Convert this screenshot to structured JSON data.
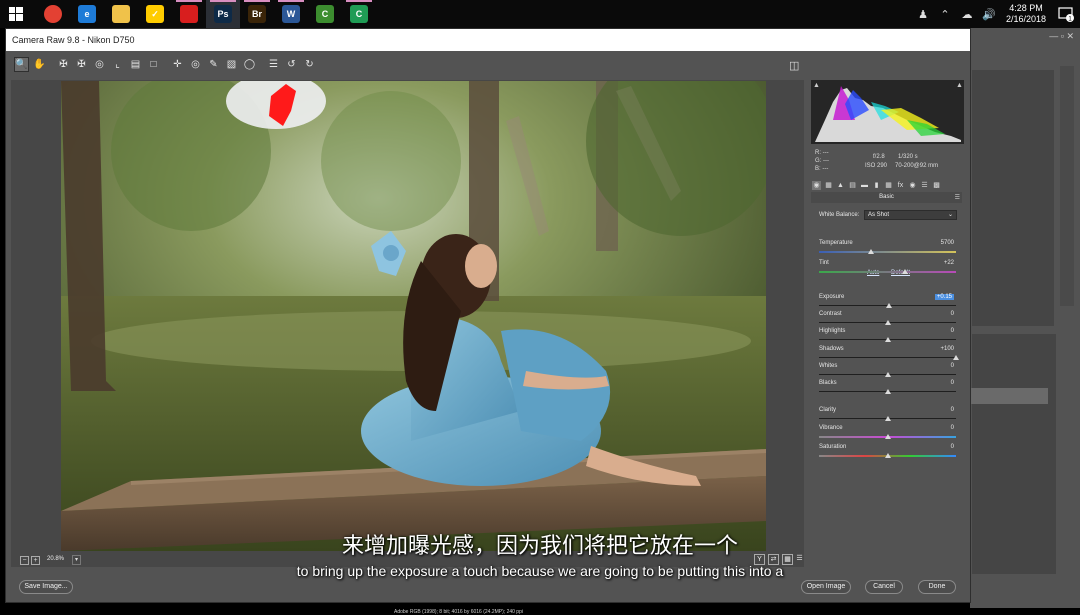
{
  "taskbar": {
    "apps": [
      {
        "name": "chrome",
        "label": "",
        "color": "#e34133",
        "active": false
      },
      {
        "name": "edge",
        "label": "e",
        "color": "#1e7bd7",
        "active": false
      },
      {
        "name": "file-explorer",
        "label": "",
        "color": "#f0c24a",
        "active": false
      },
      {
        "name": "norton",
        "label": "✓",
        "color": "#ffcc00",
        "active": false
      },
      {
        "name": "creative-cloud",
        "label": "",
        "color": "#d81e1e",
        "active": false
      },
      {
        "name": "photoshop",
        "label": "Ps",
        "color": "#0e2a47",
        "active": true
      },
      {
        "name": "bridge",
        "label": "Br",
        "color": "#3a2408",
        "active": false
      },
      {
        "name": "word",
        "label": "W",
        "color": "#2b5797",
        "active": false
      },
      {
        "name": "app-green",
        "label": "C",
        "color": "#3c8d2f",
        "active": false
      },
      {
        "name": "app-c",
        "label": "C",
        "color": "#1f9c55",
        "active": false
      }
    ],
    "time": "4:28 PM",
    "date": "2/16/2018",
    "notification_count": "1"
  },
  "dialog": {
    "title": "Camera Raw 9.8  -  Nikon D750",
    "zoom": "20.8%",
    "buttons": {
      "save_image": "Save Image...",
      "open_image": "Open Image",
      "cancel": "Cancel",
      "done": "Done"
    },
    "caption": "Adobe RGB (1998); 8 bit; 4016 by 6016 (24.2MP); 240 ppi"
  },
  "readout": {
    "r": "R:  ---",
    "g": "G:  ---",
    "b": "B:  ---",
    "aperture": "f/2.8",
    "shutter": "1/320 s",
    "iso": "ISO 290",
    "lens": "70-200@92 mm"
  },
  "panel": {
    "header": "Basic",
    "white_balance_label": "White Balance:",
    "white_balance_value": "As Shot",
    "auto": "Auto",
    "default": "Default",
    "sliders": [
      {
        "label": "Temperature",
        "value": "5700",
        "pos": 0.38
      },
      {
        "label": "Tint",
        "value": "+22",
        "pos": 0.63
      },
      {
        "label": "Exposure",
        "value": "+0.15",
        "pos": 0.51,
        "selected": true
      },
      {
        "label": "Contrast",
        "value": "0",
        "pos": 0.5
      },
      {
        "label": "Highlights",
        "value": "0",
        "pos": 0.5
      },
      {
        "label": "Shadows",
        "value": "+100",
        "pos": 1.0
      },
      {
        "label": "Whites",
        "value": "0",
        "pos": 0.5
      },
      {
        "label": "Blacks",
        "value": "0",
        "pos": 0.5
      },
      {
        "label": "Clarity",
        "value": "0",
        "pos": 0.5
      },
      {
        "label": "Vibrance",
        "value": "0",
        "pos": 0.5
      },
      {
        "label": "Saturation",
        "value": "0",
        "pos": 0.5
      }
    ]
  },
  "subtitles": {
    "chinese": "来增加曝光感，因为我们将把它放在一个",
    "english": "to bring up the exposure a touch because we are going to be putting this into a"
  },
  "colors": {
    "dialog_bg": "#535353",
    "selection": "#4b8fe0"
  }
}
